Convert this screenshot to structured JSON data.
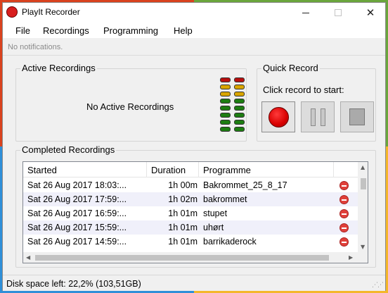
{
  "window": {
    "title": "PlayIt Recorder",
    "controls": {
      "minimize": "minimize",
      "maximize": "maximize",
      "close": "✕"
    }
  },
  "menu": [
    "File",
    "Recordings",
    "Programming",
    "Help"
  ],
  "notification": "No notifications.",
  "active_recordings": {
    "label": "Active Recordings",
    "empty_text": "No Active Recordings"
  },
  "level_meter": {
    "colors": {
      "red": "#b80f0f",
      "yellow": "#d9a500",
      "green": "#1d7d12"
    },
    "rows": [
      "red",
      "yellow",
      "yellow",
      "green",
      "green",
      "green",
      "green",
      "green"
    ]
  },
  "quick_record": {
    "label": "Quick Record",
    "hint": "Click record to start:",
    "buttons": [
      "record",
      "pause",
      "stop"
    ]
  },
  "completed_recordings": {
    "label": "Completed Recordings",
    "columns": [
      "Started",
      "Duration",
      "Programme"
    ],
    "rows": [
      {
        "started": "Sat 26 Aug 2017 18:03:...",
        "duration": "1h 00m",
        "programme": "Bakrommet_25_8_17"
      },
      {
        "started": "Sat 26 Aug 2017 17:59:...",
        "duration": "1h 02m",
        "programme": "bakrommet"
      },
      {
        "started": "Sat 26 Aug 2017 16:59:...",
        "duration": "1h 01m",
        "programme": "stupet"
      },
      {
        "started": "Sat 26 Aug 2017 15:59:...",
        "duration": "1h 01m",
        "programme": "uhørt"
      },
      {
        "started": "Sat 26 Aug 2017 14:59:...",
        "duration": "1h 01m",
        "programme": "barrikaderock"
      }
    ]
  },
  "status": "Disk space left: 22,2% (103,51GB)"
}
